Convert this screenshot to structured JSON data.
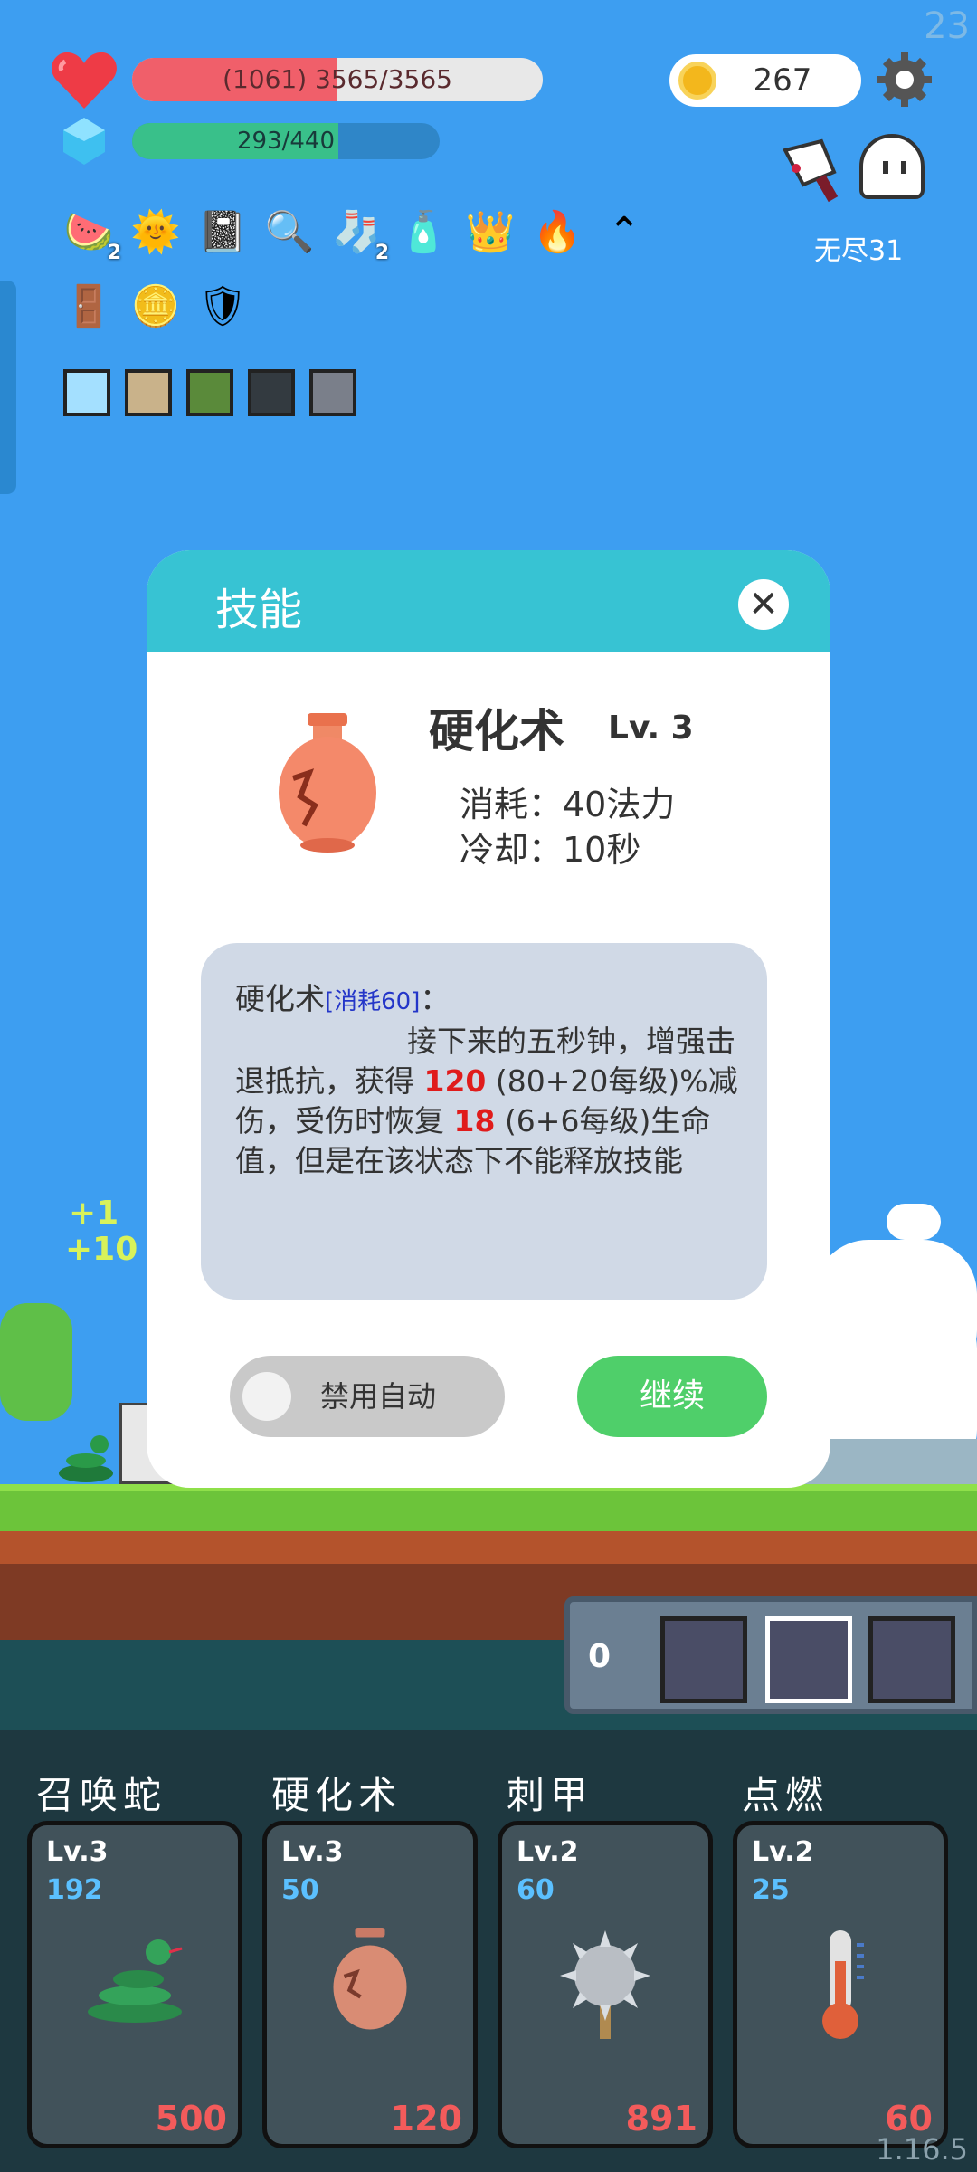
{
  "corner_counter": "23",
  "hp": {
    "text": "(1061) 3565/3565",
    "fill_fraction": 0.5
  },
  "mp": {
    "text": "293/440",
    "fill_fraction": 0.67
  },
  "gold": {
    "value": "267"
  },
  "mode": "无尽31",
  "items_row1": [
    {
      "icon": "watermelon-icon",
      "glyph": "🍉",
      "count": "2"
    },
    {
      "icon": "sun-icon",
      "glyph": "🌞",
      "count": ""
    },
    {
      "icon": "skull-book-icon",
      "glyph": "📓",
      "count": ""
    },
    {
      "icon": "magnifier-icon",
      "glyph": "🔍",
      "count": ""
    },
    {
      "icon": "sock-icon",
      "glyph": "🧦",
      "count": "2"
    },
    {
      "icon": "potion-bottle-icon",
      "glyph": "🧴",
      "count": ""
    },
    {
      "icon": "crown-icon",
      "glyph": "👑",
      "count": ""
    },
    {
      "icon": "fire-icon",
      "glyph": "🔥",
      "count": ""
    },
    {
      "icon": "collapse-chevron-icon",
      "glyph": "⌃",
      "count": ""
    }
  ],
  "items_row2": [
    {
      "icon": "door-icon",
      "glyph": "🚪",
      "count": ""
    },
    {
      "icon": "coins-icon",
      "glyph": "🪙",
      "count": ""
    },
    {
      "icon": "shield-icon",
      "glyph": "🛡",
      "count": ""
    }
  ],
  "gear_slots": [
    "lightbulb-gear-icon",
    "armor-gear-icon",
    "snake-gear-icon",
    "dark-armor-gear-icon",
    "helmet-gear-icon"
  ],
  "dialog": {
    "title": "技能",
    "skill_name": "硬化术",
    "skill_level": "Lv. 3",
    "cost": "消耗：40法力",
    "cooldown": "冷却：10秒",
    "desc_name": "硬化术",
    "desc_cost_tag": "[消耗60]",
    "desc_colon": "：",
    "desc_part1": "接下来的五秒钟，增强击退抵抗，获得",
    "desc_value1": "120",
    "desc_part2": "(80+20每级)%减伤，受伤时恢复",
    "desc_value2": "18",
    "desc_part3": "(6+6每级)生命值，但是在该状态下不能释放技能",
    "toggle_label": "禁用自动",
    "continue_label": "继续"
  },
  "slots": {
    "count": "0"
  },
  "skills": [
    {
      "title": "召唤蛇",
      "level": "Lv.3",
      "value": "192",
      "damage": "500",
      "icon": "snake-icon"
    },
    {
      "title": "硬化术",
      "level": "Lv.3",
      "value": "50",
      "damage": "120",
      "icon": "vase-icon"
    },
    {
      "title": "刺甲",
      "level": "Lv.2",
      "value": "60",
      "damage": "891",
      "icon": "spiked-mace-icon"
    },
    {
      "title": "点燃",
      "level": "Lv.2",
      "value": "25",
      "damage": "60",
      "icon": "thermometer-icon"
    }
  ],
  "version": "1.16.5",
  "colors": {
    "sky": "#3d9ef1",
    "hp": "#f05f6a",
    "mp": "#39c08a",
    "dialog_header": "#37c3d3",
    "continue": "#4fcf6a",
    "damage": "#f35b5b"
  }
}
